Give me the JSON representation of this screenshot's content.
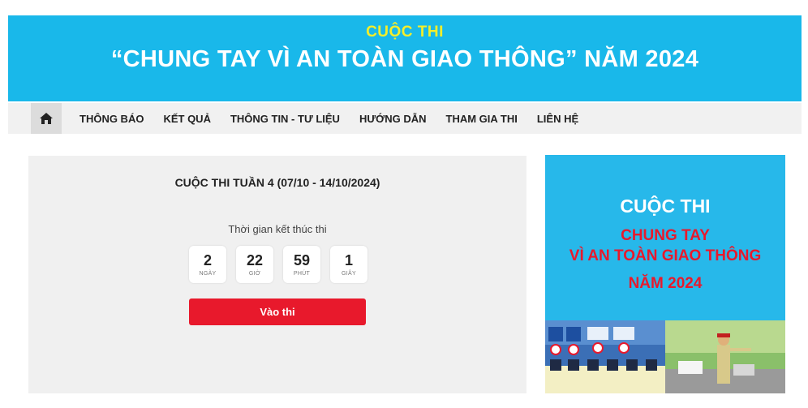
{
  "banner": {
    "subtitle": "CUỘC THI",
    "title": "“CHUNG TAY VÌ AN TOÀN GIAO THÔNG” NĂM 2024"
  },
  "nav": {
    "home_icon": "home-icon",
    "items": [
      {
        "label": "THÔNG BÁO"
      },
      {
        "label": "KẾT QUẢ"
      },
      {
        "label": "THÔNG TIN - TƯ LIỆU"
      },
      {
        "label": "HƯỚNG DẪN"
      },
      {
        "label": "THAM GIA THI"
      },
      {
        "label": "LIÊN HỆ"
      }
    ]
  },
  "contest": {
    "title": "CUỘC THI TUẦN 4 (07/10 - 14/10/2024)",
    "timer_label": "Thời gian kết thúc thi",
    "countdown": [
      {
        "value": "2",
        "unit": "NGÀY"
      },
      {
        "value": "22",
        "unit": "GIỜ"
      },
      {
        "value": "59",
        "unit": "PHÚT"
      },
      {
        "value": "1",
        "unit": "GIÂY"
      }
    ],
    "enter_label": "Vào thi"
  },
  "poster": {
    "line1": "CUỘC THI",
    "line2": "CHUNG TAY",
    "line3": "VÌ AN TOÀN GIAO THÔNG",
    "line4": "NĂM 2024"
  },
  "colors": {
    "banner_bg": "#19b8ea",
    "banner_subtitle": "#f5ee2a",
    "accent_red": "#e8192c",
    "nav_bg": "#f1f1f1",
    "panel_bg": "#f0f0f0"
  }
}
